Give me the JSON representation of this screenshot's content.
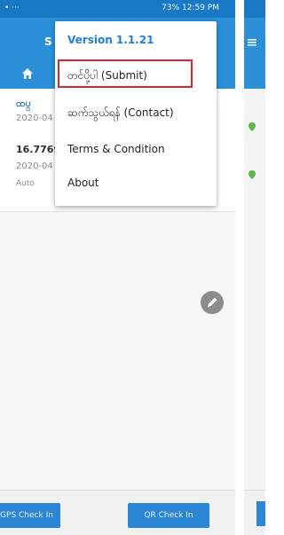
{
  "status_bar": {
    "left": "• ···",
    "right": "73% 12:59 PM"
  },
  "app": {
    "title": "S"
  },
  "list": [
    {
      "title": "ထပ္",
      "date": "2020-04",
      "note": ""
    },
    {
      "title": "16.77697",
      "date": "2020-04",
      "note": "Auto"
    }
  ],
  "menu": {
    "version": "Version 1.1.21",
    "submit": "တင်ပို့ပါ (Submit)",
    "contact": "ဆက်သွယ်ရန် (Contact)",
    "terms": "Terms & Condition",
    "about": "About"
  },
  "buttons": {
    "gps": "GPS Check In",
    "qr": "QR Check In"
  },
  "colors": {
    "primary": "#2c90d9",
    "status": "#1a79c5",
    "highlight": "#e0242d",
    "pin": "#5cb84a"
  },
  "icons": {
    "home": "home-icon",
    "edit": "pencil-icon",
    "pin": "map-pin-icon"
  }
}
